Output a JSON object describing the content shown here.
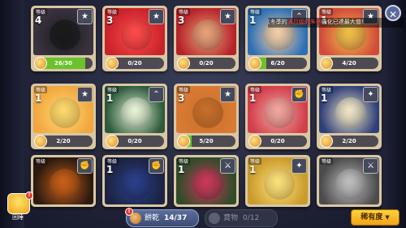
{
  "ui": {
    "level_label": "等級",
    "close_icon": "close-icon",
    "event_label": "困睡",
    "notice_prefix": "[冬季的",
    "notice_highlight": "滿月級的朱蒂",
    "notice_suffix": "強化已達最大值!",
    "tabs": {
      "cookies_label": "餅乾",
      "cookies_count": "14/37",
      "treasures_label": "寶物",
      "treasures_count": "0/12"
    },
    "sort_label": "稀有度"
  },
  "cards": [
    {
      "level": "4",
      "rank": "★",
      "progress": "26/30",
      "fill": 0.87,
      "bg": "#3a3340",
      "accent": "#1a1a1a"
    },
    {
      "level": "3",
      "rank": "★",
      "progress": "0/20",
      "fill": 0,
      "bg": "#c8232a",
      "accent": "#ff4b4b"
    },
    {
      "level": "3",
      "rank": "★",
      "progress": "0/20",
      "fill": 0,
      "bg": "#b62229",
      "accent": "#e6a37a"
    },
    {
      "level": "1",
      "rank": "⌃",
      "progress": "6/20",
      "fill": 0.3,
      "bg": "#2c6fb5",
      "accent": "#f3d0a8"
    },
    {
      "level": "1",
      "rank": "★",
      "progress": "4/20",
      "fill": 0.2,
      "bg": "#d24a3a",
      "accent": "#f0c14b"
    },
    {
      "level": "1",
      "rank": "★",
      "progress": "2/20",
      "fill": 0.1,
      "bg": "#f2a640",
      "accent": "#ffdb6e"
    },
    {
      "level": "1",
      "rank": "⌃",
      "progress": "0/20",
      "fill": 0,
      "bg": "#2d5a3c",
      "accent": "#e6f4d8"
    },
    {
      "level": "3",
      "rank": "★",
      "progress": "5/20",
      "fill": 0.25,
      "bg": "#d97a33",
      "accent": "#c8702a"
    },
    {
      "level": "1",
      "rank": "✊",
      "progress": "0/20",
      "fill": 0,
      "bg": "#d13f4b",
      "accent": "#f3a8a0"
    },
    {
      "level": "1",
      "rank": "✦",
      "progress": "2/20",
      "fill": 0.1,
      "bg": "#2f3f78",
      "accent": "#f0e7c8"
    },
    {
      "level": "",
      "rank": "✊",
      "progress": "",
      "fill": 0,
      "bg": "#2a1a10",
      "accent": "#c86018"
    },
    {
      "level": "1",
      "rank": "✊",
      "progress": "",
      "fill": 0,
      "bg": "#1b2342",
      "accent": "#2c3f8a"
    },
    {
      "level": "1",
      "rank": "⚔",
      "progress": "",
      "fill": 0,
      "bg": "#2f4c2a",
      "accent": "#c83a5a"
    },
    {
      "level": "1",
      "rank": "✦",
      "progress": "",
      "fill": 0,
      "bg": "#c99b2c",
      "accent": "#ffe27a"
    },
    {
      "level": "",
      "rank": "⚔",
      "progress": "",
      "fill": 0,
      "bg": "#4b4b4b",
      "accent": "#bfbfbf"
    }
  ]
}
